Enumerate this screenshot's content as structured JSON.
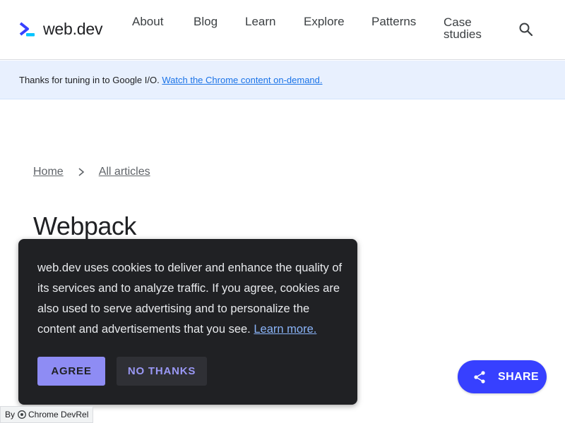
{
  "header": {
    "logo_text": "web.dev",
    "nav": [
      "About",
      "Blog",
      "Learn",
      "Explore",
      "Patterns",
      "Case studies"
    ],
    "search_icon": "search-icon"
  },
  "banner": {
    "text": "Thanks for tuning in to Google I/O.",
    "link": "Watch the Chrome content on-demand."
  },
  "breadcrumb": {
    "items": [
      "Home",
      "All articles"
    ],
    "separator_icon": "chevron-right-icon"
  },
  "main": {
    "title": "Webpack"
  },
  "cookie": {
    "text": "web.dev uses cookies to deliver and enhance the quality of its services and to analyze traffic. If you agree, cookies are also used to serve advertising and to personalize the content and advertisements that you see.",
    "link": "Learn more.",
    "agree_label": "AGREE",
    "decline_label": "NO THANKS"
  },
  "share": {
    "label": "SHARE",
    "icon": "share-icon"
  },
  "footer_tag": {
    "prefix": "By",
    "text": "Chrome DevRel",
    "icon": "chrome-icon"
  },
  "colors": {
    "brand": "#3740ff",
    "banner_bg": "#e8f0fe",
    "cookie_bg": "#202124",
    "agree_bg": "#8e8cf4"
  }
}
